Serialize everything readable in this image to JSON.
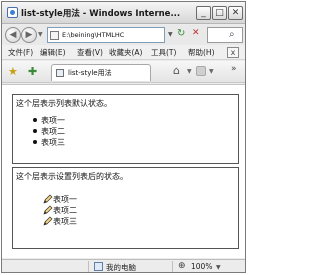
{
  "window": {
    "title": "list-style用法 - Windows Interne..."
  },
  "address": {
    "url": "E:\\beining\\HTMLHC"
  },
  "menu": {
    "file": "文件(F)",
    "edit": "编辑(E)",
    "view": "查看(V)",
    "favorites": "收藏夹(A)",
    "tools": "工具(T)",
    "help": "帮助(H)"
  },
  "tab": {
    "label": "list-style用法"
  },
  "content": {
    "section1": {
      "title": "这个层表示列表默认状态。",
      "items": [
        "表项一",
        "表项二",
        "表项三"
      ]
    },
    "section2": {
      "title": "这个层表示设置列表后的状态。",
      "items": [
        "表项一",
        "表项二",
        "表项三"
      ]
    }
  },
  "status": {
    "zone": "我的电脑",
    "zoom": "100%"
  },
  "colors": {
    "title_bar": "#d6d6d6",
    "content_bg": "#ffffff",
    "border": "#555555"
  }
}
